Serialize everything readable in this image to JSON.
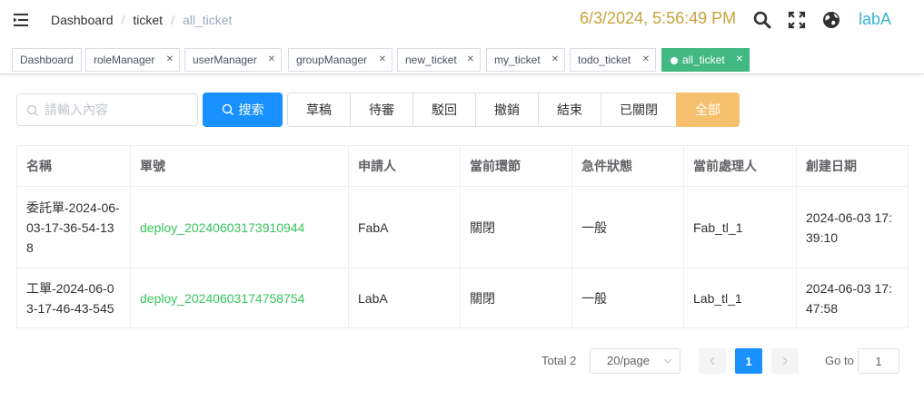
{
  "header": {
    "breadcrumb": [
      "Dashboard",
      "ticket",
      "all_ticket"
    ],
    "datetime": "6/3/2024, 5:56:49 PM",
    "user": "labA",
    "colors": {
      "datetime": "#c7a23a",
      "user": "#3ab3cf"
    }
  },
  "tags": [
    {
      "label": "Dashboard"
    },
    {
      "label": "roleManager"
    },
    {
      "label": "userManager"
    },
    {
      "label": "groupManager"
    },
    {
      "label": "new_ticket"
    },
    {
      "label": "my_ticket"
    },
    {
      "label": "todo_ticket"
    },
    {
      "label": "all_ticket",
      "active": true
    }
  ],
  "filters": {
    "search_placeholder": "請輸入內容",
    "search_button": "搜索",
    "status_buttons": [
      "草稿",
      "待審",
      "駁回",
      "撤銷",
      "結束",
      "已關閉",
      "全部"
    ],
    "active_status": "全部"
  },
  "table": {
    "columns": [
      "名稱",
      "單號",
      "申請人",
      "當前環節",
      "急件狀態",
      "當前處理人",
      "創建日期"
    ],
    "rows": [
      [
        "委託單-2024-06-03-17-36-54-138",
        "deploy_20240603173910944",
        "FabA",
        "關閉",
        "一般",
        "Fab_tl_1",
        "2024-06-03 17:39:10"
      ],
      [
        "工單-2024-06-03-17-46-43-545",
        "deploy_20240603174758754",
        "LabA",
        "關閉",
        "一般",
        "Lab_tl_1",
        "2024-06-03 17:47:58"
      ]
    ]
  },
  "pagination": {
    "total": "Total 2",
    "page_size": "20/page",
    "current_page": "1",
    "goto_label": "Go to",
    "goto_value": "1"
  }
}
